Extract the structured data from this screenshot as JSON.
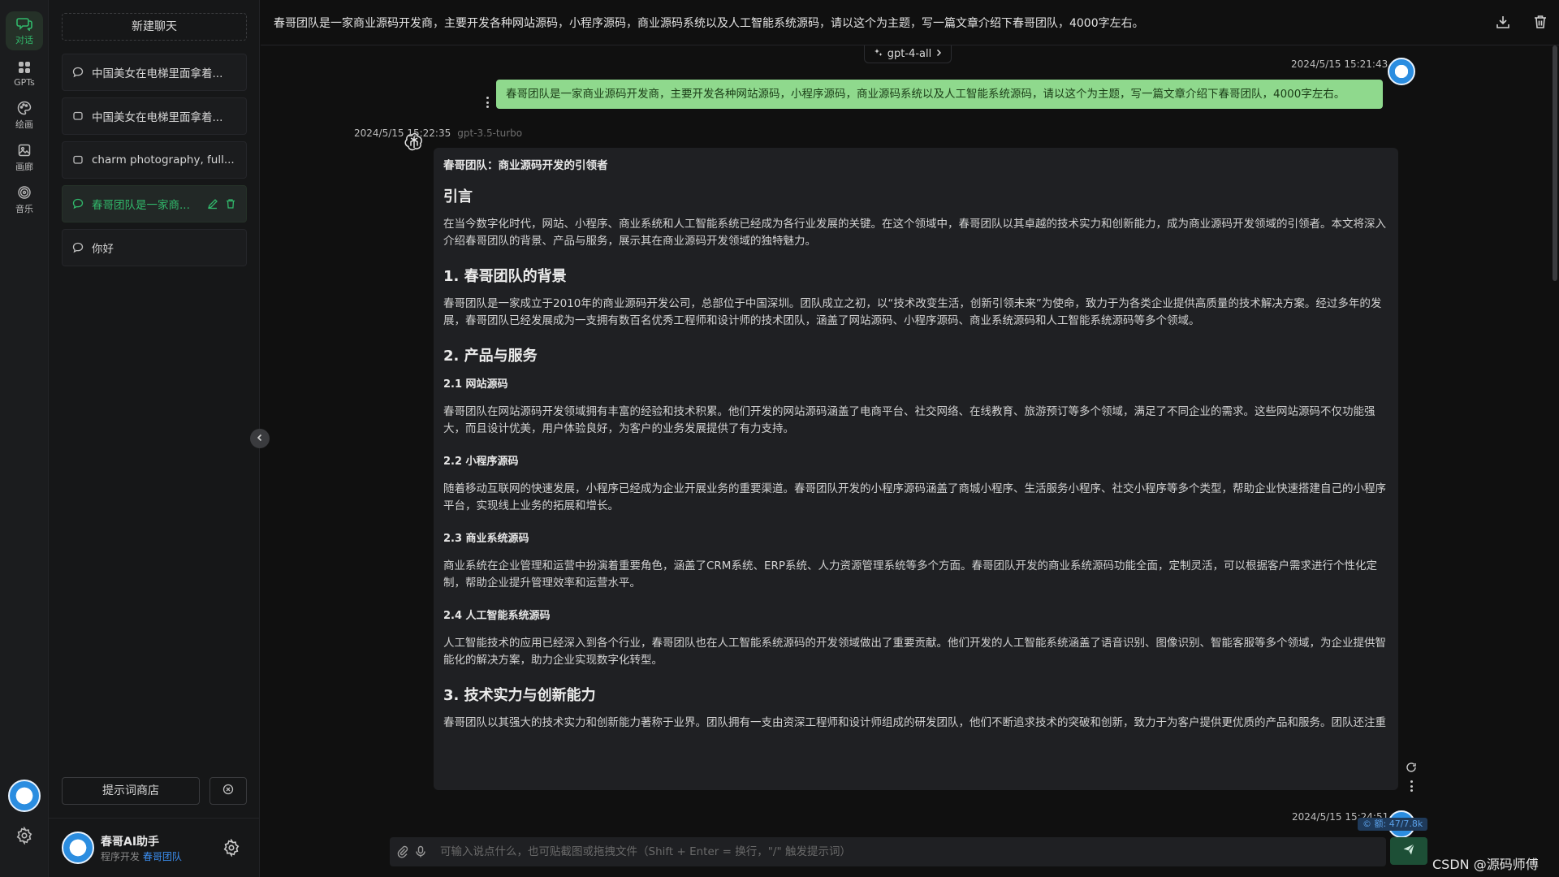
{
  "rail": {
    "items": [
      {
        "label": "对话",
        "icon": "chat-bubbles-icon",
        "active": true
      },
      {
        "label": "GPTs",
        "icon": "grid-apps-icon",
        "active": false
      },
      {
        "label": "绘画",
        "icon": "palette-icon",
        "active": false
      },
      {
        "label": "画廊",
        "icon": "image-icon",
        "active": false
      },
      {
        "label": "音乐",
        "icon": "music-disc-icon",
        "active": false
      }
    ]
  },
  "sidebar": {
    "new_chat_label": "新建聊天",
    "chats": [
      {
        "label": "中国美女在电梯里面拿着...",
        "active": false
      },
      {
        "label": "中国美女在电梯里面拿着...",
        "active": false
      },
      {
        "label": "charm photography, full...",
        "active": false
      },
      {
        "label": "春哥团队是一家商...",
        "active": true
      },
      {
        "label": "你好",
        "active": false
      }
    ],
    "prompt_store_label": "提示词商店",
    "user": {
      "name": "春哥AI助手",
      "sub_prefix": "程序开发",
      "sub_link": "春哥团队"
    }
  },
  "main": {
    "title": "春哥团队是一家商业源码开发商，主要开发各种网站源码，小程序源码，商业源码系统以及人工智能系统源码，请以这个为主题，写一篇文章介绍下春哥团队，4000字左右。",
    "model_chip": "gpt-4-all",
    "user_message": {
      "timestamp": "2024/5/15 15:21:43",
      "text": "春哥团队是一家商业源码开发商，主要开发各种网站源码，小程序源码，商业源码系统以及人工智能系统源码，请以这个为主题，写一篇文章介绍下春哥团队，4000字左右。"
    },
    "assistant_message": {
      "timestamp": "2024/5/15 15:22:35",
      "model": "gpt-3.5-turbo",
      "title": "春哥团队：商业源码开发的引领者",
      "h_intro": "引言",
      "p_intro": "在当今数字化时代，网站、小程序、商业系统和人工智能系统已经成为各行业发展的关键。在这个领域中，春哥团队以其卓越的技术实力和创新能力，成为商业源码开发领域的引领者。本文将深入介绍春哥团队的背景、产品与服务，展示其在商业源码开发领域的独特魅力。",
      "h_1": "1. 春哥团队的背景",
      "p_1": "春哥团队是一家成立于2010年的商业源码开发公司，总部位于中国深圳。团队成立之初，以“技术改变生活，创新引领未来”为使命，致力于为各类企业提供高质量的技术解决方案。经过多年的发展，春哥团队已经发展成为一支拥有数百名优秀工程师和设计师的技术团队，涵盖了网站源码、小程序源码、商业系统源码和人工智能系统源码等多个领域。",
      "h_2": "2. 产品与服务",
      "h_21": "2.1 网站源码",
      "p_21": "春哥团队在网站源码开发领域拥有丰富的经验和技术积累。他们开发的网站源码涵盖了电商平台、社交网络、在线教育、旅游预订等多个领域，满足了不同企业的需求。这些网站源码不仅功能强大，而且设计优美，用户体验良好，为客户的业务发展提供了有力支持。",
      "h_22": "2.2 小程序源码",
      "p_22": "随着移动互联网的快速发展，小程序已经成为企业开展业务的重要渠道。春哥团队开发的小程序源码涵盖了商城小程序、生活服务小程序、社交小程序等多个类型，帮助企业快速搭建自己的小程序平台，实现线上业务的拓展和增长。",
      "h_23": "2.3 商业系统源码",
      "p_23": "商业系统在企业管理和运营中扮演着重要角色，涵盖了CRM系统、ERP系统、人力资源管理系统等多个方面。春哥团队开发的商业系统源码功能全面，定制灵活，可以根据客户需求进行个性化定制，帮助企业提升管理效率和运营水平。",
      "h_24": "2.4 人工智能系统源码",
      "p_24": "人工智能技术的应用已经深入到各个行业，春哥团队也在人工智能系统源码的开发领域做出了重要贡献。他们开发的人工智能系统涵盖了语音识别、图像识别、智能客服等多个领域，为企业提供智能化的解决方案，助力企业实现数字化转型。",
      "h_3": "3. 技术实力与创新能力",
      "p_3": "春哥团队以其强大的技术实力和创新能力著称于业界。团队拥有一支由资深工程师和设计师组成的研发团队，他们不断追求技术的突破和创新，致力于为客户提供更优质的产品和服务。团队还注重"
    },
    "second_timestamp": "2024/5/15 15:24:51",
    "token_badge": "© 额: 47/7.8k",
    "input_placeholder": "可输入说点什么，也可贴截图或拖拽文件（Shift + Enter = 换行，\"/\" 触发提示词）"
  },
  "watermark": "CSDN @源码师傅",
  "colors": {
    "accent_green": "#31b86b",
    "user_bubble": "#8fd98d",
    "link_blue": "#3b8ef0"
  }
}
